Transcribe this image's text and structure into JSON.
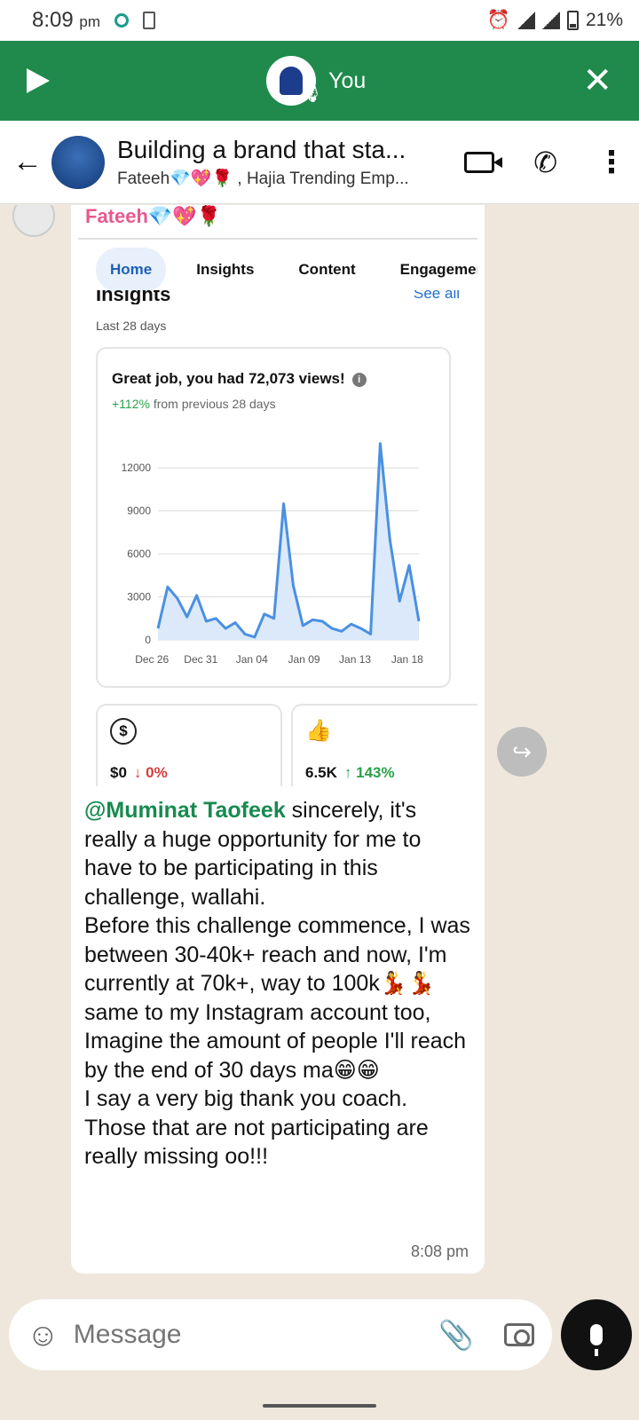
{
  "status": {
    "time": "8:09",
    "ampm": "pm",
    "battery": "21%"
  },
  "voice": {
    "label": "You"
  },
  "header": {
    "title": "Building a brand that sta...",
    "subtitle": "Fateeh💎💖🌹 , Hajia Trending Emp..."
  },
  "message": {
    "sender": "Fateeh💎💖🌹",
    "mention": "@Muminat Taofeek",
    "text": " sincerely, it's really a huge opportunity for me to have to be participating in this challenge, wallahi.\nBefore this challenge commence, I was between 30-40k+ reach and now, I'm currently at 70k+, way to 100k💃💃 same to my Instagram account too,\nImagine the amount of people I'll reach by the end of 30 days ma😁😁\nI say a very big thank you coach. Those that are not participating are really missing oo!!!",
    "time": "8:08 pm"
  },
  "screenshot": {
    "tabs": [
      "Home",
      "Insights",
      "Content",
      "Engagement"
    ],
    "heading": "Insights",
    "see_all": "See all",
    "period": "Last 28 days",
    "card_title": "Great job, you had 72,073 views!",
    "change_pct": "+112%",
    "change_rest": " from previous 28 days",
    "mini_left_value": "$0",
    "mini_left_change": "↓ 0%",
    "mini_right_value": "6.5K",
    "mini_right_change": "↑ 143%"
  },
  "chart_data": {
    "type": "area",
    "x_labels": [
      "Dec 26",
      "Dec 31",
      "Jan 04",
      "Jan 09",
      "Jan 13",
      "Jan 18"
    ],
    "y_ticks": [
      0,
      3000,
      6000,
      9000,
      12000
    ],
    "ylim": [
      0,
      13500
    ],
    "color": "#4a90e2",
    "values": [
      800,
      3700,
      2900,
      1600,
      3100,
      1300,
      1500,
      800,
      1200,
      400,
      200,
      1800,
      1500,
      9500,
      3800,
      1000,
      1400,
      1300,
      800,
      600,
      1100,
      800,
      400,
      13700,
      7000,
      2700,
      5200,
      1300
    ]
  },
  "input": {
    "placeholder": "Message"
  }
}
